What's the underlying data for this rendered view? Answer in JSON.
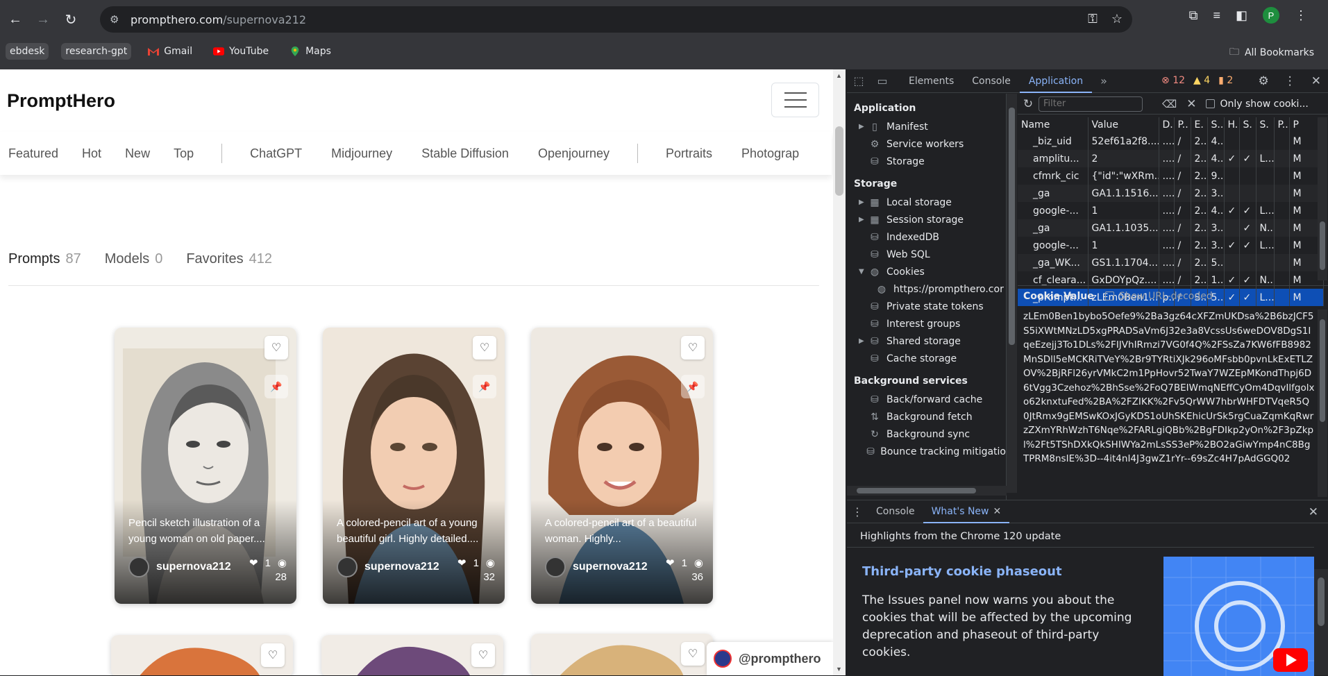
{
  "browser": {
    "url_host": "prompthero.com",
    "url_path": "/supernova212",
    "bookmarks": [
      {
        "label": "ebdesk",
        "chip": true
      },
      {
        "label": "research-gpt",
        "chip": true
      },
      {
        "label": "Gmail",
        "icon": "gmail-icon"
      },
      {
        "label": "YouTube",
        "icon": "youtube-icon"
      },
      {
        "label": "Maps",
        "icon": "maps-icon"
      }
    ],
    "all_bookmarks": "All Bookmarks",
    "profile_initial": "P"
  },
  "site": {
    "brand": "PromptHero",
    "categories_left": [
      "Featured",
      "Hot",
      "New",
      "Top"
    ],
    "categories_mid": [
      "ChatGPT",
      "Midjourney",
      "Stable Diffusion",
      "Openjourney"
    ],
    "categories_right": [
      "Portraits",
      "Photograp"
    ],
    "tabs": [
      {
        "label": "Prompts",
        "count": "87"
      },
      {
        "label": "Models",
        "count": "0"
      },
      {
        "label": "Favorites",
        "count": "412"
      }
    ],
    "cards": [
      {
        "caption": "Pencil sketch illustration of a young woman on old paper....",
        "author": "supernova212",
        "likes": "1",
        "views": "28"
      },
      {
        "caption": "A colored-pencil art of a young beautiful girl. Highly detailed....",
        "author": "supernova212",
        "likes": "1",
        "views": "32"
      },
      {
        "caption": "A colored-pencil art of a beautiful woman. Highly...",
        "author": "supernova212",
        "likes": "1",
        "views": "36"
      }
    ],
    "handle": "@prompthero"
  },
  "devtools": {
    "tabs": [
      "Elements",
      "Console",
      "Application"
    ],
    "active_tab": "Application",
    "errors": "12",
    "warnings": "4",
    "issues": "2",
    "sidebar": {
      "application_header": "Application",
      "application_items": [
        "Manifest",
        "Service workers",
        "Storage"
      ],
      "storage_header": "Storage",
      "storage_items": [
        "Local storage",
        "Session storage",
        "IndexedDB",
        "Web SQL",
        "Cookies",
        "https://prompthero.cor",
        "Private state tokens",
        "Interest groups",
        "Shared storage",
        "Cache storage"
      ],
      "bg_header": "Background services",
      "bg_items": [
        "Back/forward cache",
        "Background fetch",
        "Background sync",
        "Bounce tracking mitigatio"
      ]
    },
    "filter_placeholder": "Filter",
    "only_show": "Only show cooki...",
    "columns": [
      "Name",
      "Value",
      "D.",
      "P..",
      "E.",
      "S..",
      "H.",
      "S.",
      "S.",
      "P..",
      "P"
    ],
    "cookies": [
      {
        "name": "_biz_uid",
        "value": "52ef61a2f8....",
        "d": "....",
        "p": "/",
        "e": "2...",
        "s": "4....",
        "h": "",
        "s2": "",
        "s3": "",
        "p2": "",
        "p3": "M"
      },
      {
        "name": "amplitu...",
        "value": "2",
        "d": "....",
        "p": "/",
        "e": "2...",
        "s": "4....",
        "h": "✓",
        "s2": "✓",
        "s3": "L...",
        "p2": "",
        "p3": "M"
      },
      {
        "name": "cfmrk_cic",
        "value": "{\"id\":\"wXRm....",
        "d": "....",
        "p": "/",
        "e": "2...",
        "s": "9....",
        "h": "",
        "s2": "",
        "s3": "",
        "p2": "",
        "p3": "M"
      },
      {
        "name": "_ga",
        "value": "GA1.1.1516....",
        "d": "....",
        "p": "/",
        "e": "2...",
        "s": "3....",
        "h": "",
        "s2": "",
        "s3": "",
        "p2": "",
        "p3": "M"
      },
      {
        "name": "google-...",
        "value": "1",
        "d": "....",
        "p": "/",
        "e": "2...",
        "s": "4....",
        "h": "✓",
        "s2": "✓",
        "s3": "L...",
        "p2": "",
        "p3": "M"
      },
      {
        "name": "_ga",
        "value": "GA1.1.1035....",
        "d": "....",
        "p": "/",
        "e": "2...",
        "s": "3....",
        "h": "",
        "s2": "✓",
        "s3": "N...",
        "p2": "",
        "p3": "M"
      },
      {
        "name": "google-...",
        "value": "1",
        "d": "....",
        "p": "/",
        "e": "2...",
        "s": "3....",
        "h": "✓",
        "s2": "✓",
        "s3": "L...",
        "p2": "",
        "p3": "M"
      },
      {
        "name": "_ga_WK...",
        "value": "GS1.1.1704....",
        "d": "....",
        "p": "/",
        "e": "2...",
        "s": "5....",
        "h": "",
        "s2": "",
        "s3": "",
        "p2": "",
        "p3": "M"
      },
      {
        "name": "cf_cleara...",
        "value": "GxDOYpQz....",
        "d": "....",
        "p": "/",
        "e": "2...",
        "s": "1....",
        "h": "✓",
        "s2": "✓",
        "s3": "N...",
        "p2": "",
        "p3": "M"
      },
      {
        "name": "_prompt...",
        "value": "zLEm0Ben1....",
        "d": "p...",
        "p": "/",
        "e": "S...",
        "s": "5....",
        "h": "✓",
        "s2": "✓",
        "s3": "L...",
        "p2": "",
        "p3": "M"
      }
    ],
    "cookie_value_label": "Cookie Value",
    "show_url_decoded": "Show URL-decoded",
    "cookie_value": "zLEm0Ben1bybo5Oefe9%2Ba3gz64cXFZmUKDsa%2B6bzJCF5S5iXWtMNzLD5xgPRADSaVm6J32e3a8VcssUs6weDOV8DgS1IqeEzejj3To1DLs%2FIJVhIRmzi7VG0f4Q%2FSsZa7KW6fFB8982MnSDll5eMCKRiTVeY%2Br9TYRtiXJk296oMFsbb0pvnLkExETLZOV%2BjRFl26yrVMkC2m1PpHovr52TwaY7WZEpMKondThpj6D6tVgg3Czehoz%2BhSse%2FoQ7BEIWmqNEffCyOm4DqvIlfgolxo62knxtuFed%2BA%2FZIKK%2Fv5QrWW7hbrWHFDTVqeR5Q0JtRmx9gEMSwKOxJGyKDS1oUhSKEhicUrSk5rgCuaZqmKqRwrzZXmYRhWzhT6Nqe%2FARLgiQBb%2BgFDIkp2yOn%2F3pZkpl%2Ft5TShDXkQkSHIWYa2mLsSS3eP%2BO2aGiwYmp4nC8BgTPRM8nsIE%3D--4it4nI4J3gwZ1rYr--69sZc4H7pAdGGQ02",
    "drawer_tabs": [
      "Console",
      "What's New"
    ],
    "whatsnew_sub": "Highlights from the Chrome 120 update",
    "whatsnew_title": "Third-party cookie phaseout",
    "whatsnew_desc": "The Issues panel now warns you about the cookies that will be affected by the upcoming deprecation and phaseout of third-party cookies."
  }
}
